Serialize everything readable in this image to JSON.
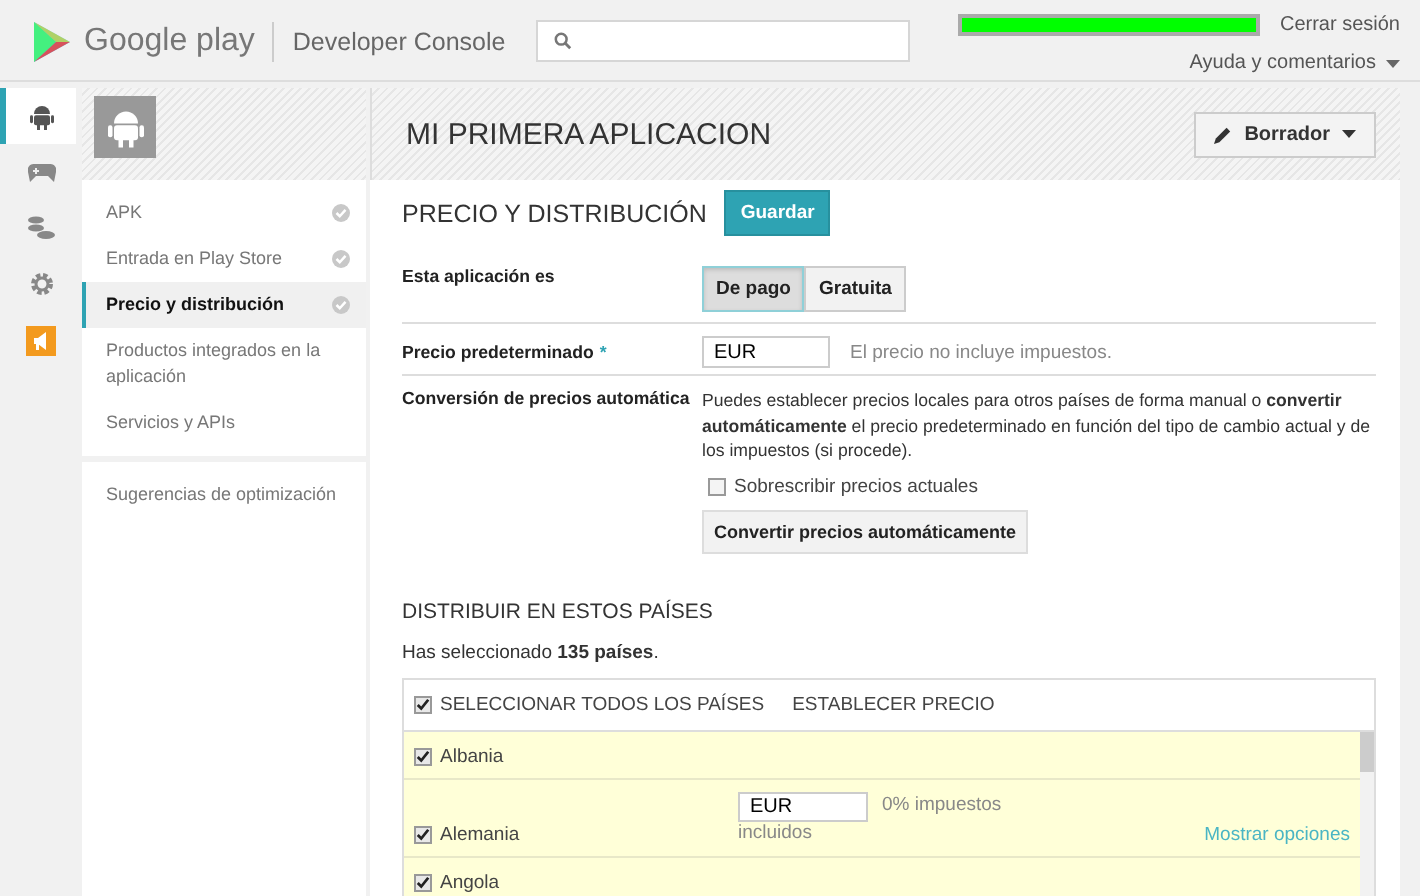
{
  "header": {
    "brand": "Google play",
    "product": "Developer Console",
    "sign_out": "Cerrar sesión",
    "help": "Ayuda y comentarios"
  },
  "rail": [
    {
      "kind": "android",
      "selected": true
    },
    {
      "kind": "gamepad",
      "selected": false
    },
    {
      "kind": "coins",
      "selected": false
    },
    {
      "kind": "gear",
      "selected": false
    },
    {
      "kind": "megaphone",
      "selected": false
    }
  ],
  "nav": {
    "items": [
      {
        "label": "APK",
        "complete": true,
        "selected": false
      },
      {
        "label": "Entrada en Play Store",
        "complete": true,
        "selected": false
      },
      {
        "label": "Precio y distribución",
        "complete": true,
        "selected": true
      },
      {
        "label": "Productos integrados en la aplicación",
        "complete": false,
        "selected": false
      },
      {
        "label": "Servicios y APIs",
        "complete": false,
        "selected": false
      }
    ],
    "footer": "Sugerencias de optimización"
  },
  "app": {
    "title": "MI PRIMERA APLICACION",
    "status_button": "Borrador"
  },
  "section": {
    "title": "PRECIO Y DISTRIBUCIÓN",
    "save": "Guardar"
  },
  "app_type": {
    "label": "Esta aplicación es",
    "options": [
      {
        "label": "De pago",
        "selected": true
      },
      {
        "label": "Gratuita",
        "selected": false
      }
    ]
  },
  "default_price": {
    "label": "Precio predeterminado",
    "required_mark": "*",
    "value": "EUR",
    "hint": "El precio no incluye impuestos."
  },
  "auto_conversion": {
    "label": "Conversión de precios automática",
    "description": "Puedes establecer precios locales para otros países de forma manual o **convertir automáticamente** el precio predeterminado en función del tipo de cambio actual y de los impuestos (si procede).",
    "overwrite": {
      "label": "Sobrescribir precios actuales",
      "checked": false
    },
    "button": "Convertir precios automáticamente"
  },
  "distribution": {
    "title": "DISTRIBUIR EN ESTOS PAÍSES",
    "summary": "Has seleccionado **135 países**.",
    "select_all": {
      "label": "SELECCIONAR TODOS LOS PAÍSES",
      "checked": true
    },
    "column_2": "ESTABLECER PRECIO",
    "rows": [
      {
        "country": "Albania",
        "checked": true
      },
      {
        "country": "Alemania",
        "checked": true,
        "price": {
          "value": "EUR",
          "tax": "0% impuestos",
          "tax_wrap": "incluidos",
          "link": "Mostrar opciones"
        }
      },
      {
        "country": "Angola",
        "checked": true
      }
    ]
  }
}
